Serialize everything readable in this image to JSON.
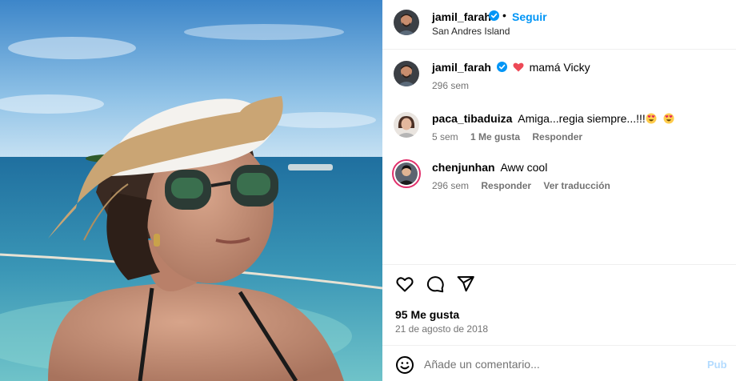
{
  "post": {
    "author": "jamil_farah",
    "follow_label": "Seguir",
    "separator": "•",
    "location": "San Andres Island"
  },
  "comments": [
    {
      "username": "jamil_farah",
      "verified": true,
      "text": "mamá Vicky",
      "time": "296 sem",
      "likes": "",
      "reply": "",
      "translate": ""
    },
    {
      "username": "paca_tibaduiza",
      "verified": false,
      "text": "Amiga...regia siempre...!!!",
      "time": "5 sem",
      "likes": "1 Me gusta",
      "reply": "Responder",
      "translate": ""
    },
    {
      "username": "chenjunhan",
      "verified": false,
      "text": "Aww cool",
      "time": "296 sem",
      "likes": "",
      "reply": "Responder",
      "translate": "Ver traducción"
    }
  ],
  "actions": {
    "like_icon": "heart-outline-icon",
    "comment_icon": "speech-bubble-icon",
    "share_icon": "paper-plane-icon"
  },
  "likes_count": "95 Me gusta",
  "date": "21 de agosto de 2018",
  "add_comment": {
    "placeholder": "Añade un comentario...",
    "publish_label": "Pub"
  },
  "colors": {
    "link_blue": "#0095f6",
    "verified_blue": "#0095f6",
    "heart_red": "#ed4956",
    "muted": "#737373",
    "story_ring": "#e1306c"
  }
}
